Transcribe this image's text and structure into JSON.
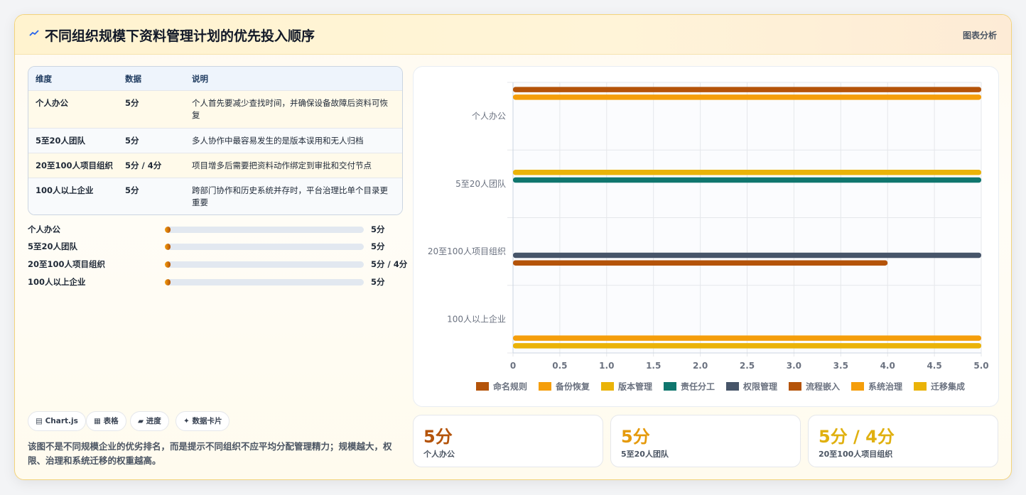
{
  "header": {
    "title": "不同组织规模下资料管理计划的优先投入顺序",
    "link": "图表分析"
  },
  "table": {
    "headers": [
      "维度",
      "数据",
      "说明"
    ],
    "rows": [
      [
        "个人办公",
        "5分",
        "个人首先要减少查找时间，并确保设备故障后资料可恢复"
      ],
      [
        "5至20人团队",
        "5分",
        "多人协作中最容易发生的是版本误用和无人归档"
      ],
      [
        "20至100人项目组织",
        "5分 / 4分",
        "项目增多后需要把资料动作绑定到审批和交付节点"
      ],
      [
        "100人以上企业",
        "5分",
        "跨部门协作和历史系统并存时，平台治理比单个目录更重要"
      ]
    ]
  },
  "progress": [
    {
      "label": "个人办公",
      "value": "5分",
      "fraction": 0.03
    },
    {
      "label": "5至20人团队",
      "value": "5分",
      "fraction": 0.03
    },
    {
      "label": "20至100人项目组织",
      "value": "5分 / 4分",
      "fraction": 0.03
    },
    {
      "label": "100人以上企业",
      "value": "5分",
      "fraction": 0.03
    }
  ],
  "chips": [
    {
      "label": "▤ Chart.js"
    },
    {
      "label": "▦ 表格"
    },
    {
      "label": "▰ 进度"
    },
    {
      "label": "✦ 数据卡片"
    }
  ],
  "note": "该图不是不同规模企业的优劣排名，而是提示不同组织不应平均分配管理精力；规模越大，权限、治理和系统迁移的权重越高。",
  "stats": [
    {
      "value": "5分",
      "label": "个人办公",
      "color": "#b45309"
    },
    {
      "value": "5分",
      "label": "5至20人团队",
      "color": "#e59a0c"
    },
    {
      "value": "5分 / 4分",
      "label": "20至100人项目组织",
      "color": "#e0b00f"
    }
  ],
  "chart_data": {
    "type": "bar",
    "orientation": "horizontal",
    "categories": [
      "个人办公",
      "5至20人团队",
      "20至100人项目组织",
      "100人以上企业"
    ],
    "series": [
      {
        "name": "命名规则",
        "color": "#b45309",
        "values": [
          5,
          null,
          null,
          null
        ]
      },
      {
        "name": "备份恢复",
        "color": "#f59e0b",
        "values": [
          5,
          null,
          null,
          null
        ]
      },
      {
        "name": "版本管理",
        "color": "#eab308",
        "values": [
          null,
          5,
          null,
          null
        ]
      },
      {
        "name": "责任分工",
        "color": "#0f766e",
        "values": [
          null,
          5,
          null,
          null
        ]
      },
      {
        "name": "权限管理",
        "color": "#475569",
        "values": [
          null,
          null,
          5,
          null
        ]
      },
      {
        "name": "流程嵌入",
        "color": "#b45309",
        "values": [
          null,
          null,
          4,
          null
        ]
      },
      {
        "name": "系统治理",
        "color": "#f59e0b",
        "values": [
          null,
          null,
          null,
          5
        ]
      },
      {
        "name": "迁移集成",
        "color": "#eab308",
        "values": [
          null,
          null,
          null,
          5
        ]
      }
    ],
    "xlim": [
      0,
      5
    ],
    "xticks": [
      "0",
      "0.5",
      "1.0",
      "1.5",
      "2.0",
      "2.5",
      "3.0",
      "3.5",
      "4.0",
      "4.5",
      "5.0"
    ],
    "grid": true,
    "legend": "bottom"
  }
}
